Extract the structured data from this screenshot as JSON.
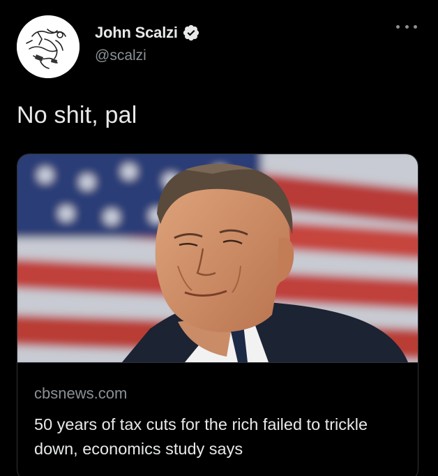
{
  "author": {
    "display_name": "John Scalzi",
    "handle": "@scalzi",
    "verified": true,
    "avatar_icon": "sketch-avatar-icon"
  },
  "tweet": {
    "text": "No shit, pal"
  },
  "link_card": {
    "image_icon": "portrait-photo-icon",
    "domain": "cbsnews.com",
    "title": "50 years of tax cuts for the rich failed to trickle down, economics study says"
  },
  "colors": {
    "background": "#000000",
    "text_primary": "#e7e9ea",
    "text_secondary": "#8b9196",
    "verified_badge": "#e7e9ea",
    "card_border": "#2f3336"
  },
  "icons": {
    "more": "more-options-icon",
    "verified": "verified-badge-icon"
  }
}
